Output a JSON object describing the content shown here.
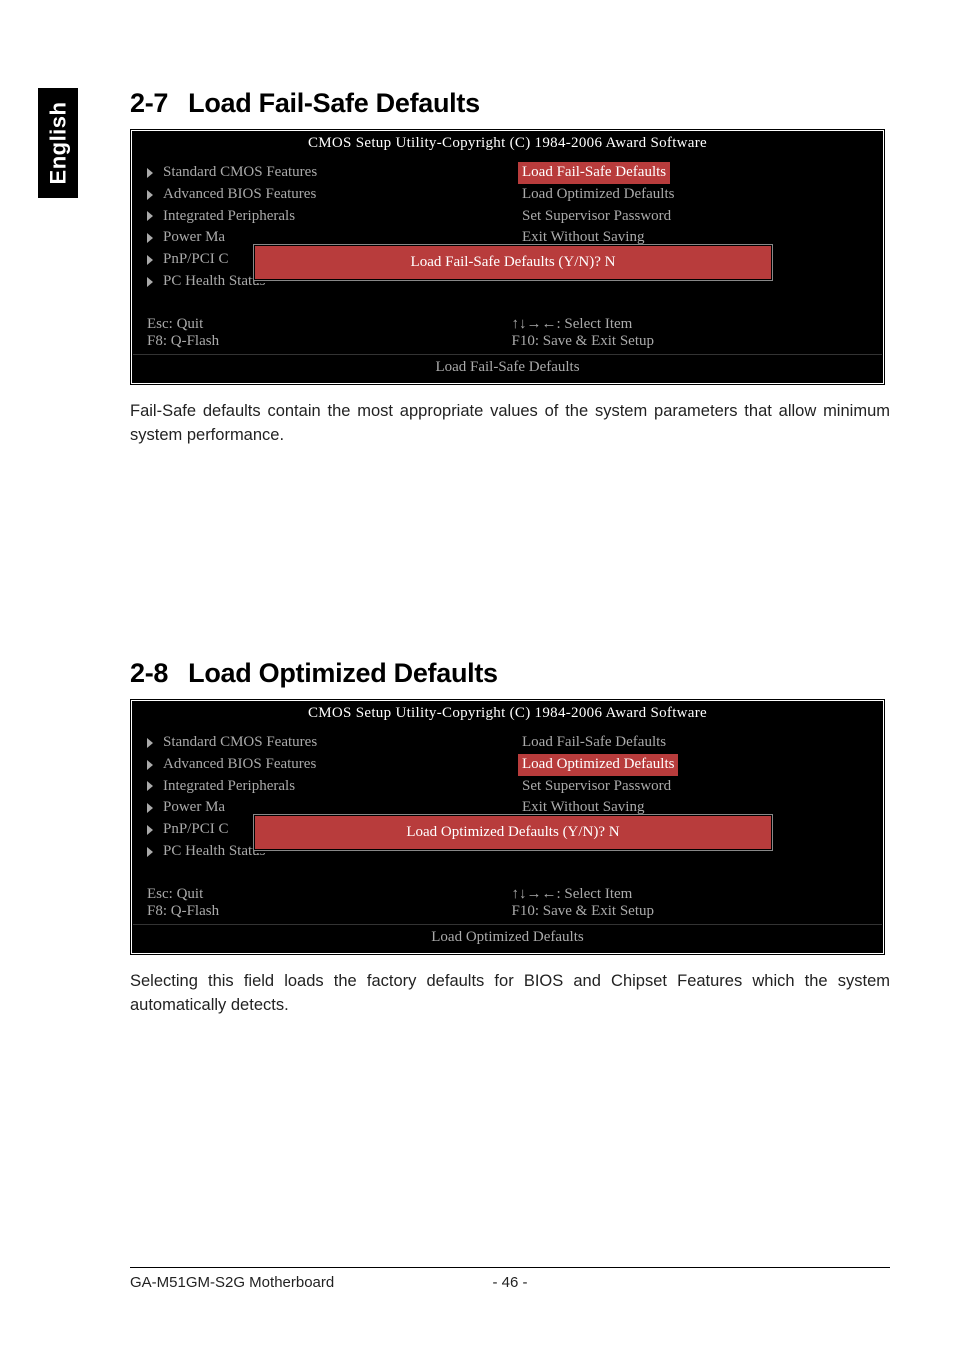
{
  "side_tab": "English",
  "section1": {
    "num": "2-7",
    "title": "Load Fail-Safe Defaults",
    "bios": {
      "title": "CMOS Setup Utility-Copyright (C) 1984-2006 Award Software",
      "left_items": [
        "Standard CMOS Features",
        "Advanced BIOS Features",
        "Integrated Peripherals",
        "Power Ma",
        "PnP/PCI C",
        "PC Health Status"
      ],
      "right_items": [
        "Load Fail-Safe Defaults",
        "Load Optimized Defaults",
        "Set Supervisor Password",
        "",
        "",
        "Exit Without Saving"
      ],
      "selected_right_index": 0,
      "dialog": "Load Fail-Safe Defaults (Y/N)? N",
      "hint_left1": "Esc: Quit",
      "hint_left2": "F8: Q-Flash",
      "hint_right1": "↑↓→←: Select Item",
      "hint_right2": "F10: Save & Exit Setup",
      "footer": "Load Fail-Safe Defaults"
    },
    "body": "Fail-Safe defaults contain the most appropriate values of the system parameters that allow minimum system performance."
  },
  "section2": {
    "num": "2-8",
    "title": "Load Optimized Defaults",
    "bios": {
      "title": "CMOS Setup Utility-Copyright (C) 1984-2006 Award Software",
      "left_items": [
        "Standard CMOS Features",
        "Advanced BIOS Features",
        "Integrated Peripherals",
        "Power Ma",
        "PnP/PCI C",
        "PC Health Status"
      ],
      "right_items": [
        "Load Fail-Safe Defaults",
        "Load Optimized Defaults",
        "Set Supervisor Password",
        "",
        "",
        "Exit Without Saving"
      ],
      "selected_right_index": 1,
      "dialog": "Load Optimized Defaults (Y/N)? N",
      "hint_left1": "Esc: Quit",
      "hint_left2": "F8: Q-Flash",
      "hint_right1": "↑↓→←: Select Item",
      "hint_right2": "F10: Save & Exit Setup",
      "footer": "Load Optimized Defaults"
    },
    "body": "Selecting this field loads the factory defaults for BIOS and Chipset Features which the system automatically detects."
  },
  "footer": {
    "left": "GA-M51GM-S2G Motherboard",
    "center": "- 46 -",
    "right": ""
  }
}
